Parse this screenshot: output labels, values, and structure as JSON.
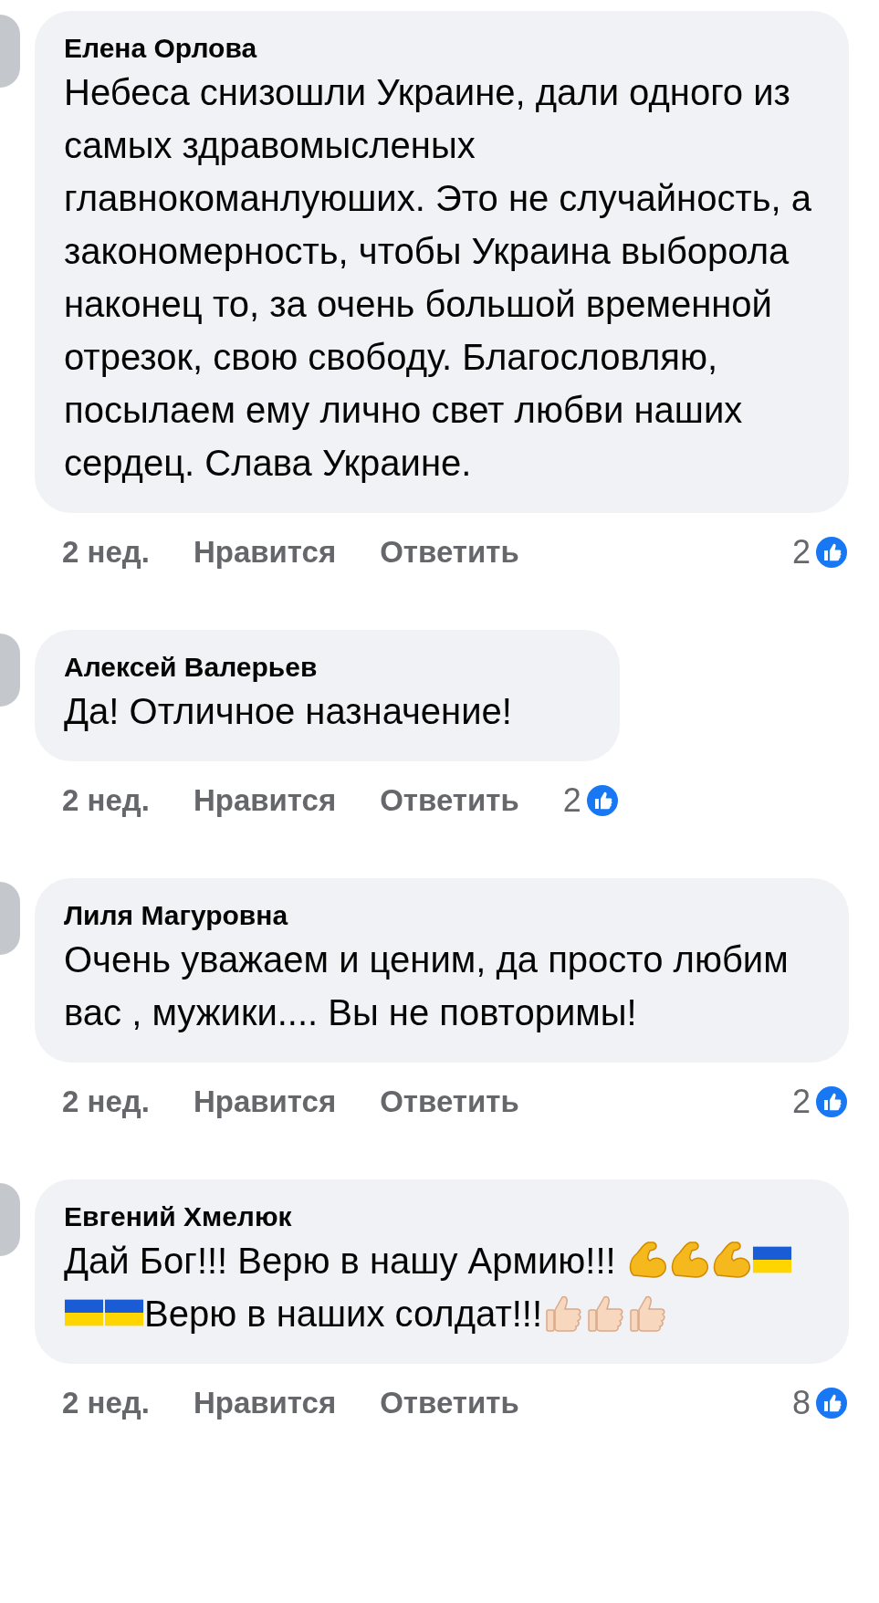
{
  "comments": [
    {
      "author": "Елена Орлова",
      "body": [
        {
          "kind": "text",
          "text": "Небеса снизошли Украине, дали одного из самых здравомысленых главнокоманлуюших. Это не случайность, а закономерность, чтобы Украина выборола наконец то, за очень большой временной отрезок, свою свободу. Благословляю, посылаем ему лично свет любви наших сердец. Слава Украине."
        }
      ],
      "time": "2 нед.",
      "like_label": "Нравится",
      "reply_label": "Ответить",
      "reactions": "2"
    },
    {
      "author": "Алексей Валерьев",
      "body": [
        {
          "kind": "text",
          "text": "Да! Отличное назначение!"
        }
      ],
      "time": "2 нед.",
      "like_label": "Нравится",
      "reply_label": "Ответить",
      "reactions": "2"
    },
    {
      "author": "Лиля Магуровна",
      "body": [
        {
          "kind": "text",
          "text": "Очень уважаем и ценим, да просто любим вас , мужики.... Вы не повторимы!"
        }
      ],
      "time": "2 нед.",
      "like_label": "Нравится",
      "reply_label": "Ответить",
      "reactions": "2"
    },
    {
      "author": "Евгений Хмелюк",
      "body": [
        {
          "kind": "text",
          "text": "Дай Бог!!! Верю в нашу Армию!!! "
        },
        {
          "kind": "muscle"
        },
        {
          "kind": "muscle"
        },
        {
          "kind": "muscle"
        },
        {
          "kind": "flag"
        },
        {
          "kind": "flag"
        },
        {
          "kind": "flag"
        },
        {
          "kind": "text",
          "text": "Верю в наших солдат!!!"
        },
        {
          "kind": "thumb"
        },
        {
          "kind": "thumb"
        },
        {
          "kind": "thumb"
        }
      ],
      "time": "2 нед.",
      "like_label": "Нравится",
      "reply_label": "Ответить",
      "reactions": "8"
    }
  ]
}
